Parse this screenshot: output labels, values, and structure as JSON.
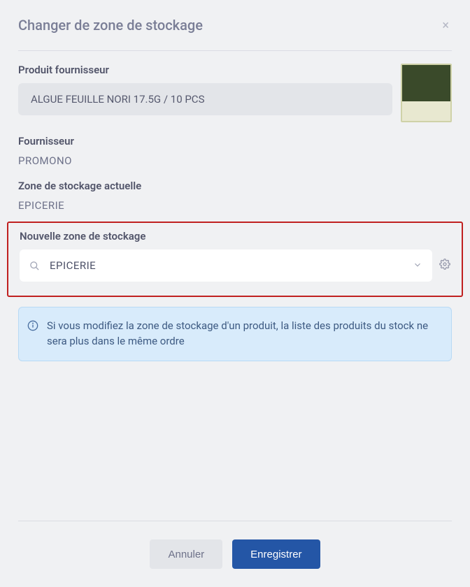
{
  "header": {
    "title": "Changer de zone de stockage"
  },
  "fields": {
    "product_label": "Produit fournisseur",
    "product_value": "ALGUE FEUILLE NORI 17.5G / 10 PCS",
    "supplier_label": "Fournisseur",
    "supplier_value": "PROMONO",
    "current_zone_label": "Zone de stockage actuelle",
    "current_zone_value": "EPICERIE",
    "new_zone_label": "Nouvelle zone de stockage",
    "new_zone_value": "EPICERIE"
  },
  "info": {
    "text": "Si vous modifiez la zone de stockage d'un produit, la liste des produits du stock ne sera plus dans le même ordre"
  },
  "footer": {
    "cancel": "Annuler",
    "save": "Enregistrer"
  },
  "colors": {
    "accent": "#2456a6",
    "highlight": "#c02020",
    "info_bg": "#d8ebfb"
  }
}
